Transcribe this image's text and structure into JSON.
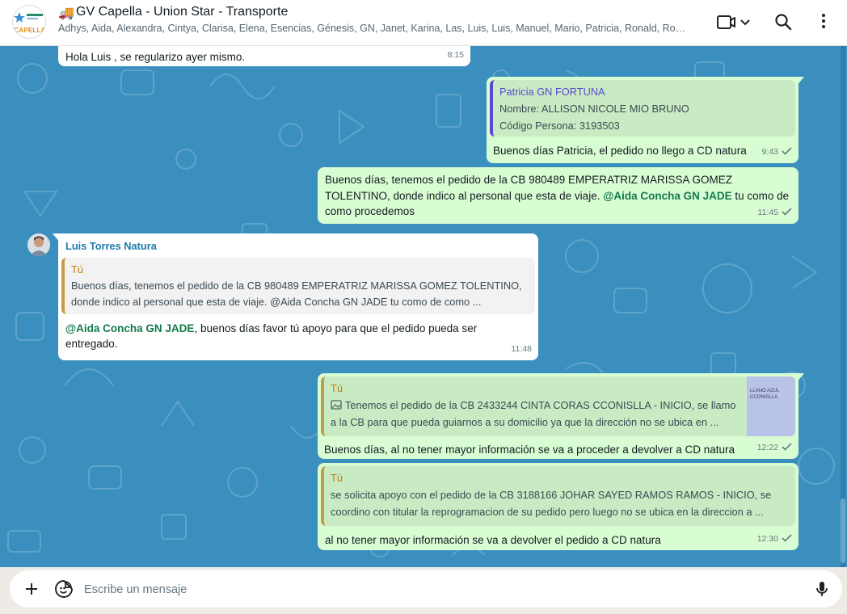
{
  "header": {
    "group_logo_text": "CAPELLA",
    "truck_icon": "🚚",
    "title": "GV Capella - Union Star - Transporte",
    "members": "Adhys, Aida, Alexandra, Cintya, Clarisa, Elena, Esencias, Génesis, GN, Janet, Karina, Las, Luis, Luis, Manuel, Mario, Patricia, Ronald, Rosa,..."
  },
  "messages": {
    "m1": {
      "text": "Hola Luis , se regularizo ayer mismo.",
      "time": "8:15"
    },
    "m2": {
      "quote_author": "Patricia GN FORTUNA",
      "quote_line1": "Nombre: ALLISON NICOLE MIO BRUNO",
      "quote_line2": "Código Persona: 3193503",
      "text": "Buenos días Patricia, el pedido no llego a CD natura",
      "time": "9:43"
    },
    "m3": {
      "text_before": "Buenos días, tenemos el pedido de la CB 980489 EMPERATRIZ MARISSA GOMEZ TOLENTINO, donde indico al personal que esta de viaje. ",
      "mention": "@Aida Concha GN JADE",
      "text_after": " tu como de como procedemos",
      "time": "11:45"
    },
    "m4": {
      "sender": "Luis Torres Natura",
      "quote_author": "Tú",
      "quote_text": "Buenos días, tenemos el pedido de la CB 980489 EMPERATRIZ MARISSA GOMEZ TOLENTINO, donde indico al personal que esta de viaje. @Aida Concha GN JADE tu como de como ...",
      "mention": "@Aida Concha GN JADE",
      "text_after": ", buenos días favor tú apoyo para que el pedido pueda ser entregado.",
      "time": "11:48"
    },
    "m5": {
      "quote_author": "Tú",
      "quote_text": "Tenemos el pedido de la CB 2433244 CINTA CORAS CCONISLLA - INICIO, se llamo a la CB para que pueda guiarnos a su domicilio ya que la dirección no se ubica en ...",
      "thumb_line1": "LLANO AZUL",
      "thumb_line2": "CCONISLLA",
      "text": "Buenos días, al no tener mayor información se va a proceder a devolver a CD natura",
      "time": "12:22"
    },
    "m6": {
      "quote_author": "Tú",
      "quote_text": "se solicita apoyo con el pedido de la CB 3188166 JOHAR SAYED RAMOS RAMOS - INICIO, se coordino con titular la reprogramacion de su pedido pero luego no se ubica en la direccion a ...",
      "text": "al no tener mayor información se va a devolver el pedido a CD natura",
      "time": "12:30"
    }
  },
  "composer": {
    "placeholder": "Escribe un mensaje"
  },
  "colors": {
    "chat_bg": "#3b8fbf",
    "outgoing": "#d9fdd3",
    "incoming": "#ffffff",
    "accent_green": "#137a4b",
    "quote_purple": "#5b48d1",
    "quote_orange": "#c27c0e"
  }
}
